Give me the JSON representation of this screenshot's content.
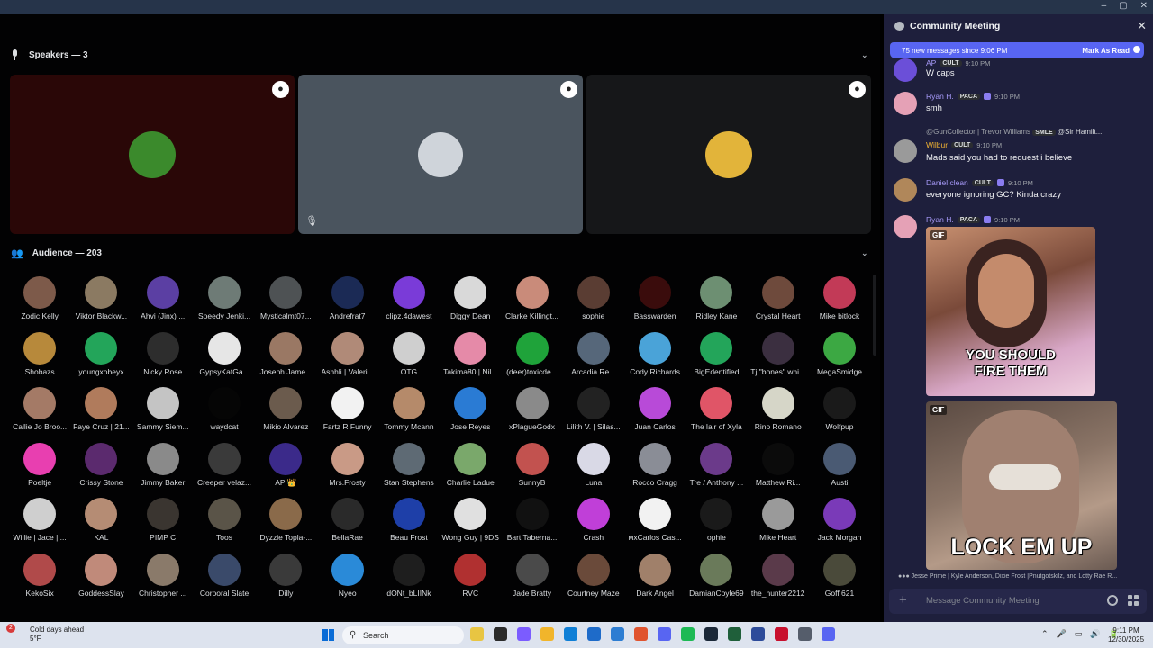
{
  "window": {
    "minimize": "–",
    "maximize": "▢",
    "close": "✕"
  },
  "stage": {
    "speakers_header": "Speakers — 3",
    "audience_header": "Audience — 203",
    "chevron": "⌄",
    "speakers": [
      {
        "bg": "#2a0707",
        "avatar_color": "#3b8a2c",
        "muted": false
      },
      {
        "bg": "#4a545e",
        "avatar_color": "#cfd4da",
        "muted": true
      },
      {
        "bg": "#161719",
        "avatar_color": "#e2b43a",
        "muted": false
      }
    ],
    "muted_icon": "🎙"
  },
  "audience": [
    {
      "name": "Zodic Kelly",
      "c": "#7d5a4a"
    },
    {
      "name": "Viktor Blackw...",
      "c": "#8b7a62"
    },
    {
      "name": "Ahvi (Jinx) ...",
      "c": "#5b3fa3"
    },
    {
      "name": "Speedy Jenki...",
      "c": "#6e7b76"
    },
    {
      "name": "Mysticalmt07...",
      "c": "#4e5254"
    },
    {
      "name": "Andrefrat7",
      "c": "#1b2a55"
    },
    {
      "name": "clipz.4dawest",
      "c": "#7a3bd8"
    },
    {
      "name": "Diggy Dean",
      "c": "#d9d9d9"
    },
    {
      "name": "Clarke Killingt...",
      "c": "#c98b7a"
    },
    {
      "name": "sophie",
      "c": "#5a3d33"
    },
    {
      "name": "Basswarden",
      "c": "#3a0c0c"
    },
    {
      "name": "Ridley Kane",
      "c": "#6d8f72"
    },
    {
      "name": "Crystal Heart",
      "c": "#6e4a3c"
    },
    {
      "name": "Mike bitlock",
      "c": "#c23a57"
    },
    {
      "name": "Shobazs",
      "c": "#b7893b"
    },
    {
      "name": "youngxobeyx",
      "c": "#23a55a"
    },
    {
      "name": "Nicky Rose",
      "c": "#2d2d2d"
    },
    {
      "name": "GypsyKatGa...",
      "c": "#e6e6e6"
    },
    {
      "name": "Joseph Jame...",
      "c": "#9a7864"
    },
    {
      "name": "Ashhli | Valeri...",
      "c": "#b08a78"
    },
    {
      "name": "OTG",
      "c": "#cfcfcf"
    },
    {
      "name": "Takima80 | Nil...",
      "c": "#e58aa8"
    },
    {
      "name": "(deer)toxicde...",
      "c": "#1fa33a"
    },
    {
      "name": "Arcadia Re...",
      "c": "#56677a"
    },
    {
      "name": "Cody Richards",
      "c": "#4aa3d8"
    },
    {
      "name": "BigEdentified",
      "c": "#23a55a"
    },
    {
      "name": "Tj \"bones\" whi...",
      "c": "#3b2f40"
    },
    {
      "name": "MegaSmidge",
      "c": "#3ca843"
    },
    {
      "name": "Callie Jo Broo...",
      "c": "#a47a66"
    },
    {
      "name": "Faye Cruz | 21...",
      "c": "#b07b5c"
    },
    {
      "name": "Sammy Siem...",
      "c": "#c4c4c4"
    },
    {
      "name": "waydcat",
      "c": "#050505"
    },
    {
      "name": "Mikio Alvarez",
      "c": "#6b5b4d"
    },
    {
      "name": "Fartz R Funny",
      "c": "#f2f2f2"
    },
    {
      "name": "Tommy Mcann",
      "c": "#b58a6a"
    },
    {
      "name": "Jose Reyes",
      "c": "#2a7bd4"
    },
    {
      "name": "xPlagueGodx",
      "c": "#8a8a8a"
    },
    {
      "name": "Lilith V. | Silas...",
      "c": "#222222"
    },
    {
      "name": "Juan Carlos",
      "c": "#b84ad8"
    },
    {
      "name": "The lair of Xyla",
      "c": "#e05567"
    },
    {
      "name": "Rino Romano",
      "c": "#d6d6c8"
    },
    {
      "name": "Wolfpup",
      "c": "#1a1a1a"
    },
    {
      "name": "Poeltje",
      "c": "#e83fb0"
    },
    {
      "name": "Crissy Stone",
      "c": "#5b2a6e"
    },
    {
      "name": "Jimmy Baker",
      "c": "#8a8a8a"
    },
    {
      "name": "Creeper velaz...",
      "c": "#3a3a3a"
    },
    {
      "name": "AP 👑",
      "c": "#3b2a8a"
    },
    {
      "name": "Mrs.Frosty",
      "c": "#c99a86"
    },
    {
      "name": "Stan Stephens",
      "c": "#5e6a74"
    },
    {
      "name": "Charlie Ladue",
      "c": "#7aa86b"
    },
    {
      "name": "SunnyB",
      "c": "#c2524f"
    },
    {
      "name": "Luna",
      "c": "#d9d9e6"
    },
    {
      "name": "Rocco Cragg",
      "c": "#8a8d96"
    },
    {
      "name": "Tre / Anthony ...",
      "c": "#6b3a8a"
    },
    {
      "name": "Matthew Ri...",
      "c": "#0b0b0b"
    },
    {
      "name": "Austi",
      "c": "#4a5a73"
    },
    {
      "name": "Willie | Jace | ...",
      "c": "#cfcfcf"
    },
    {
      "name": "KAL",
      "c": "#b58c74"
    },
    {
      "name": "PIMP C",
      "c": "#3a3530"
    },
    {
      "name": "Toos",
      "c": "#5a5448"
    },
    {
      "name": "Dyzzie Topla-...",
      "c": "#8a6a4a"
    },
    {
      "name": "BellaRae",
      "c": "#2a2a2a"
    },
    {
      "name": "Beau Frost",
      "c": "#1e3fa8"
    },
    {
      "name": "Wong Guy | 9DS",
      "c": "#e0e0e0"
    },
    {
      "name": "Bart Taberna...",
      "c": "#111111"
    },
    {
      "name": "Crash",
      "c": "#c03fd8"
    },
    {
      "name": "мxCarlos Cas...",
      "c": "#f2f2f2"
    },
    {
      "name": "ophie",
      "c": "#1a1a1a"
    },
    {
      "name": "Mike Heart",
      "c": "#9a9a9a"
    },
    {
      "name": "Jack Morgan",
      "c": "#7a3ab8"
    },
    {
      "name": "KekoSix",
      "c": "#b04a4a"
    },
    {
      "name": "GoddessSlay",
      "c": "#c08a7a"
    },
    {
      "name": "Christopher ...",
      "c": "#8a7a6a"
    },
    {
      "name": "Corporal Slate",
      "c": "#3a4a6a"
    },
    {
      "name": "Dilly",
      "c": "#3a3a3a"
    },
    {
      "name": "Nyeo",
      "c": "#2a8ad8"
    },
    {
      "name": "dONt_bLIINk",
      "c": "#1e1e1e"
    },
    {
      "name": "RVC",
      "c": "#b03030"
    },
    {
      "name": "Jade Bratty",
      "c": "#4a4a4a"
    },
    {
      "name": "Courtney Maze",
      "c": "#6a4a3a"
    },
    {
      "name": "Dark Angel",
      "c": "#a0806a"
    },
    {
      "name": "DamianCoyle69",
      "c": "#6a7a5a"
    },
    {
      "name": "the_hunter2212",
      "c": "#5a3a4a"
    },
    {
      "name": "Goff 621",
      "c": "#4a4a3a"
    }
  ],
  "chat": {
    "title": "Community Meeting",
    "close": "✕",
    "banner_left": "75 new messages since 9:06 PM",
    "banner_right": "Mark As Read",
    "messages": [
      {
        "user": "AP",
        "tag": "CULT",
        "time": "9:10 PM",
        "text": "W caps",
        "avatar": "#6b4fd8"
      },
      {
        "user": "Ryan H.",
        "tag": "PACA",
        "time": "9:10 PM",
        "text": "smh",
        "avatar": "#e5a1b6"
      },
      {
        "reply_user": "@GunCollector | Trevor Williams",
        "reply_tag": "SMLE",
        "reply_text": "@Sir Hamilt...",
        "user": "Wilbur",
        "tag": "CULT",
        "time": "9:10 PM",
        "text": "Mads said you had to request i believe",
        "avatar": "#9a9a9a"
      },
      {
        "user": "Daniel clean",
        "tag": "CULT",
        "time": "9:10 PM",
        "text": "everyone ignoring GC? Kinda crazy",
        "avatar": "#b0875a"
      },
      {
        "user": "Ryan H.",
        "tag": "PACA",
        "time": "9:10 PM",
        "text": "",
        "avatar": "#e5a1b6"
      }
    ],
    "gif1": {
      "tag": "GIF",
      "caption_1": "YOU SHOULD",
      "caption_2": "FIRE THEM"
    },
    "gif2": {
      "tag": "GIF",
      "caption": "LOCK EM UP"
    },
    "typing": "Jesse Prime | Kyle Anderson, Dixie Frost |Pnutgotskilz, and Lotty Rae R...",
    "composer_placeholder": "Message Community Meeting",
    "plus": "+"
  },
  "taskbar": {
    "weather_title": "Cold days ahead",
    "weather_temp": "5°F",
    "weather_badge": "2",
    "search": "Search",
    "time": "9:11 PM",
    "date": "12/30/2025",
    "tray": [
      "⌃",
      "🎤",
      "▭",
      "🔊",
      "🔋"
    ],
    "apps": [
      "#e8c542",
      "#2b2b2b",
      "#7b5cff",
      "#f1b52b",
      "#0f7fd6",
      "#1e6bc9",
      "#2d7dd2",
      "#e0542f",
      "#5865f2",
      "#1db954",
      "#1b2838",
      "#1f5f3a",
      "#2d4b9a",
      "#c8102e",
      "#555d6b",
      "#5865f2"
    ]
  }
}
